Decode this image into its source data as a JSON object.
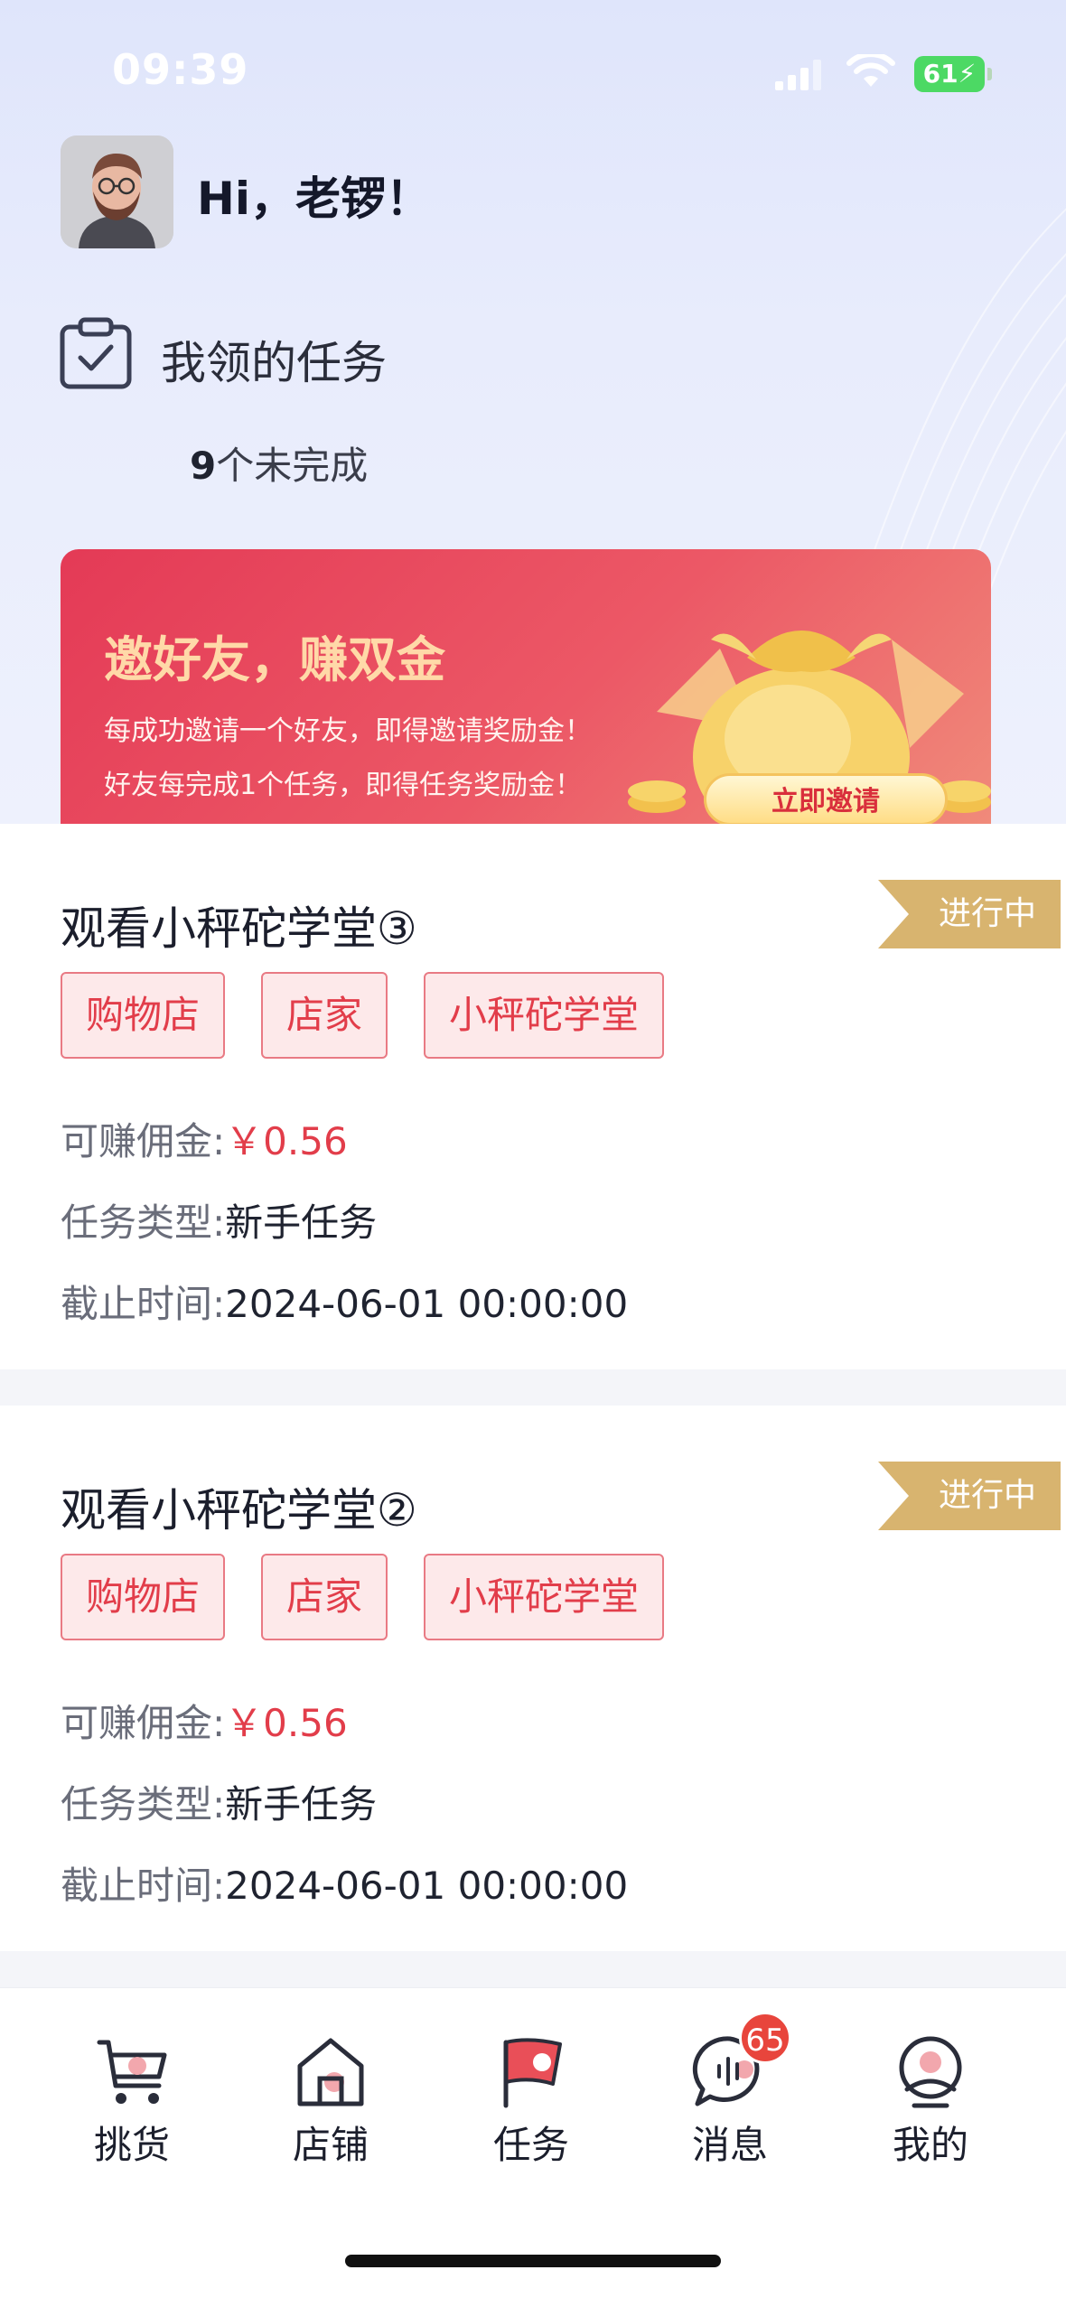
{
  "status_bar": {
    "time": "09:39",
    "battery": "61"
  },
  "header": {
    "greeting": "Hi，老锣！",
    "my_tasks_title": "我领的任务",
    "unfinished_count": "9",
    "unfinished_label": "个未完成"
  },
  "banner": {
    "title": "邀好友，赚双金",
    "line1": "每成功邀请一个好友，即得邀请奖励金！",
    "line2": "好友每完成1个任务，即得任务奖励金！",
    "button": "立即邀请"
  },
  "tasks": [
    {
      "title": "观看小秤砣学堂③",
      "status": "进行中",
      "tags": [
        "购物店",
        "店家",
        "小秤砣学堂"
      ],
      "commission_label": "可赚佣金:",
      "commission_value": "￥0.56",
      "type_label": "任务类型:",
      "type_value": "新手任务",
      "deadline_label": "截止时间:",
      "deadline_value": "2024-06-01 00:00:00"
    },
    {
      "title": "观看小秤砣学堂②",
      "status": "进行中",
      "tags": [
        "购物店",
        "店家",
        "小秤砣学堂"
      ],
      "commission_label": "可赚佣金:",
      "commission_value": "￥0.56",
      "type_label": "任务类型:",
      "type_value": "新手任务",
      "deadline_label": "截止时间:",
      "deadline_value": "2024-06-01 00:00:00"
    }
  ],
  "tab_bar": {
    "items": [
      {
        "label": "挑货",
        "icon": "cart-icon"
      },
      {
        "label": "店铺",
        "icon": "store-icon"
      },
      {
        "label": "任务",
        "icon": "flag-icon"
      },
      {
        "label": "消息",
        "icon": "message-icon",
        "badge": "65"
      },
      {
        "label": "我的",
        "icon": "profile-icon"
      }
    ]
  },
  "colors": {
    "accent": "#e23d4a",
    "status_tag": "#d8b46f",
    "banner": "#e43a56"
  }
}
